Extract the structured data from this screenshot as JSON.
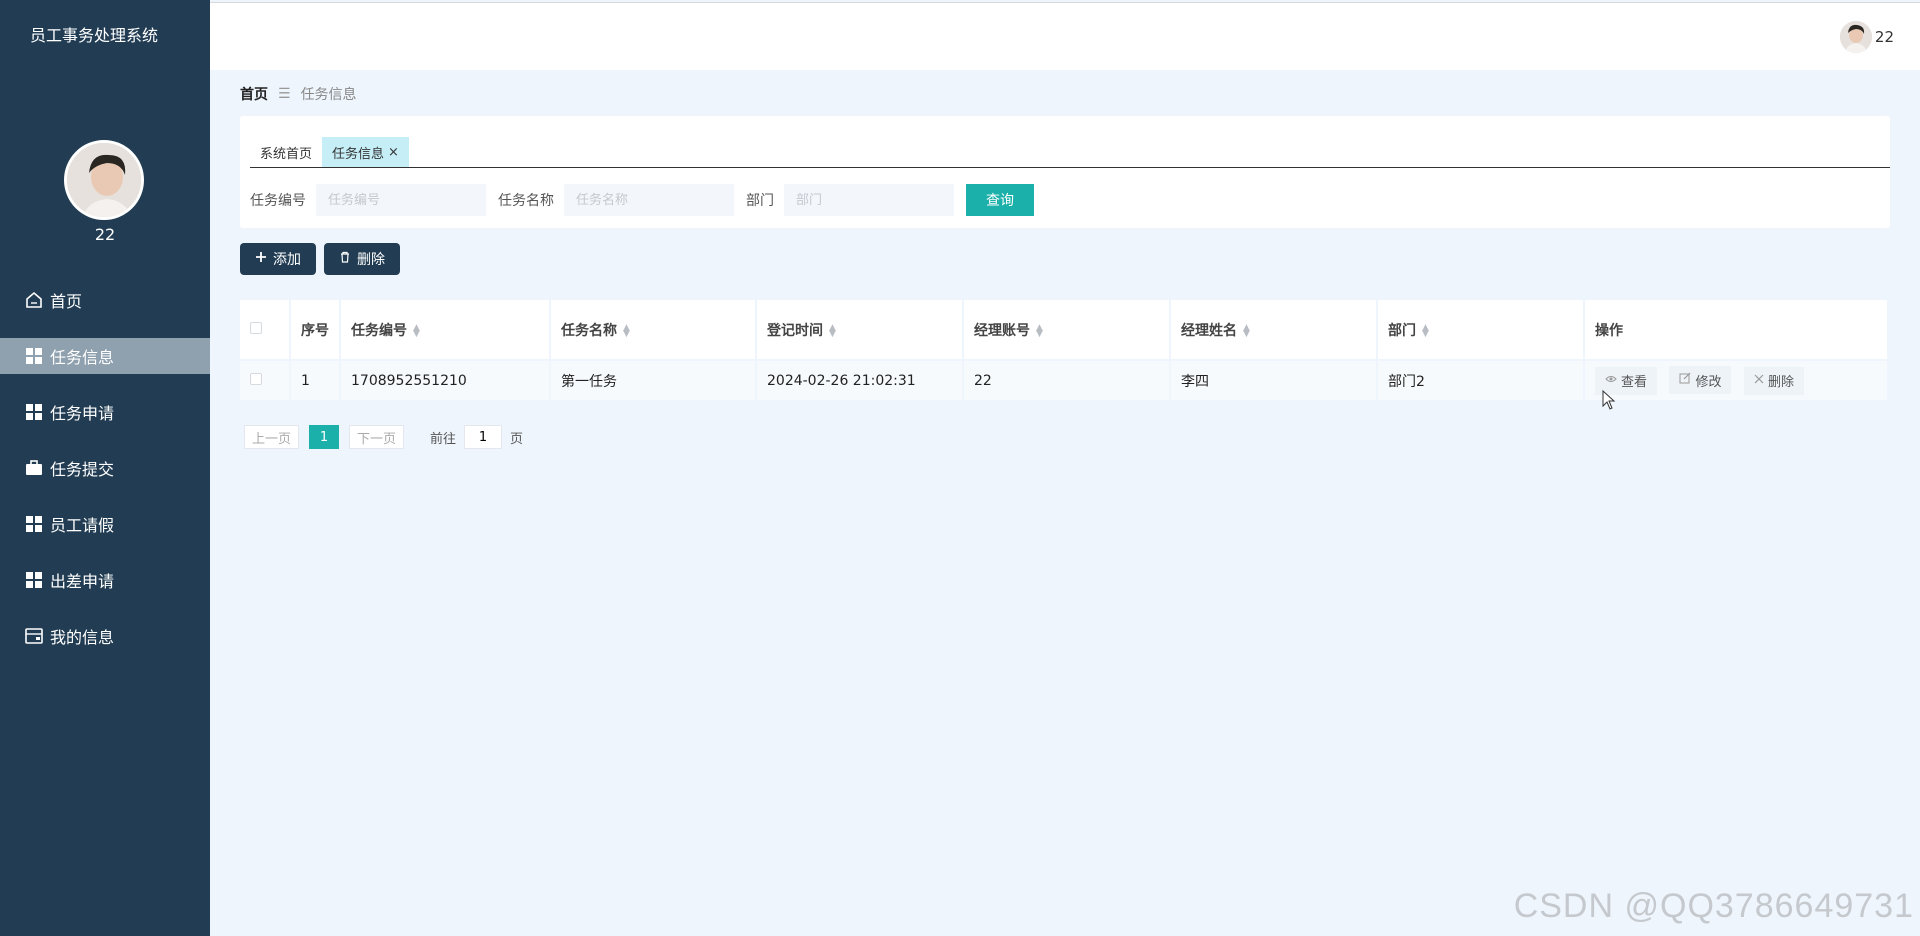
{
  "app": {
    "title": "员工事务处理系统",
    "username": "22"
  },
  "sidebar": {
    "items": [
      {
        "label": "首页",
        "icon": "home-icon",
        "active": false
      },
      {
        "label": "任务信息",
        "icon": "grid-icon",
        "active": true
      },
      {
        "label": "任务申请",
        "icon": "grid-icon",
        "active": false
      },
      {
        "label": "任务提交",
        "icon": "briefcase-icon",
        "active": false
      },
      {
        "label": "员工请假",
        "icon": "grid-icon",
        "active": false
      },
      {
        "label": "出差申请",
        "icon": "grid-icon",
        "active": false
      },
      {
        "label": "我的信息",
        "icon": "card-icon",
        "active": false
      }
    ]
  },
  "header": {
    "username": "22"
  },
  "breadcrumb": {
    "home": "首页",
    "separator": "☰",
    "current": "任务信息"
  },
  "tabs": [
    {
      "label": "系统首页"
    },
    {
      "label": "任务信息",
      "close": "×"
    }
  ],
  "search": {
    "fields": [
      {
        "label": "任务编号",
        "placeholder": "任务编号",
        "value": ""
      },
      {
        "label": "任务名称",
        "placeholder": "任务名称",
        "value": ""
      },
      {
        "label": "部门",
        "placeholder": "部门",
        "value": ""
      }
    ],
    "query_label": "查询"
  },
  "actions": {
    "add_label": "添加",
    "delete_label": "删除"
  },
  "table": {
    "columns": [
      "序号",
      "任务编号",
      "任务名称",
      "登记时间",
      "经理账号",
      "经理姓名",
      "部门",
      "操作"
    ],
    "rows": [
      {
        "index": "1",
        "task_no": "1708952551210",
        "task_name": "第一任务",
        "time": "2024-02-26 21:02:31",
        "manager_account": "22",
        "manager_name": "李四",
        "department": "部门2"
      }
    ],
    "row_actions": {
      "view": "查看",
      "edit": "修改",
      "delete": "删除"
    }
  },
  "pagination": {
    "prev": "上一页",
    "next": "下一页",
    "current": "1",
    "goto_prefix": "前往",
    "goto_value": "1",
    "goto_suffix": "页"
  },
  "watermark": "CSDN @QQ3786649731",
  "colors": {
    "sidebar": "#223d53",
    "accent": "#1cb0ab",
    "active_menu": "#8fa0af",
    "background": "#eef5fc"
  }
}
